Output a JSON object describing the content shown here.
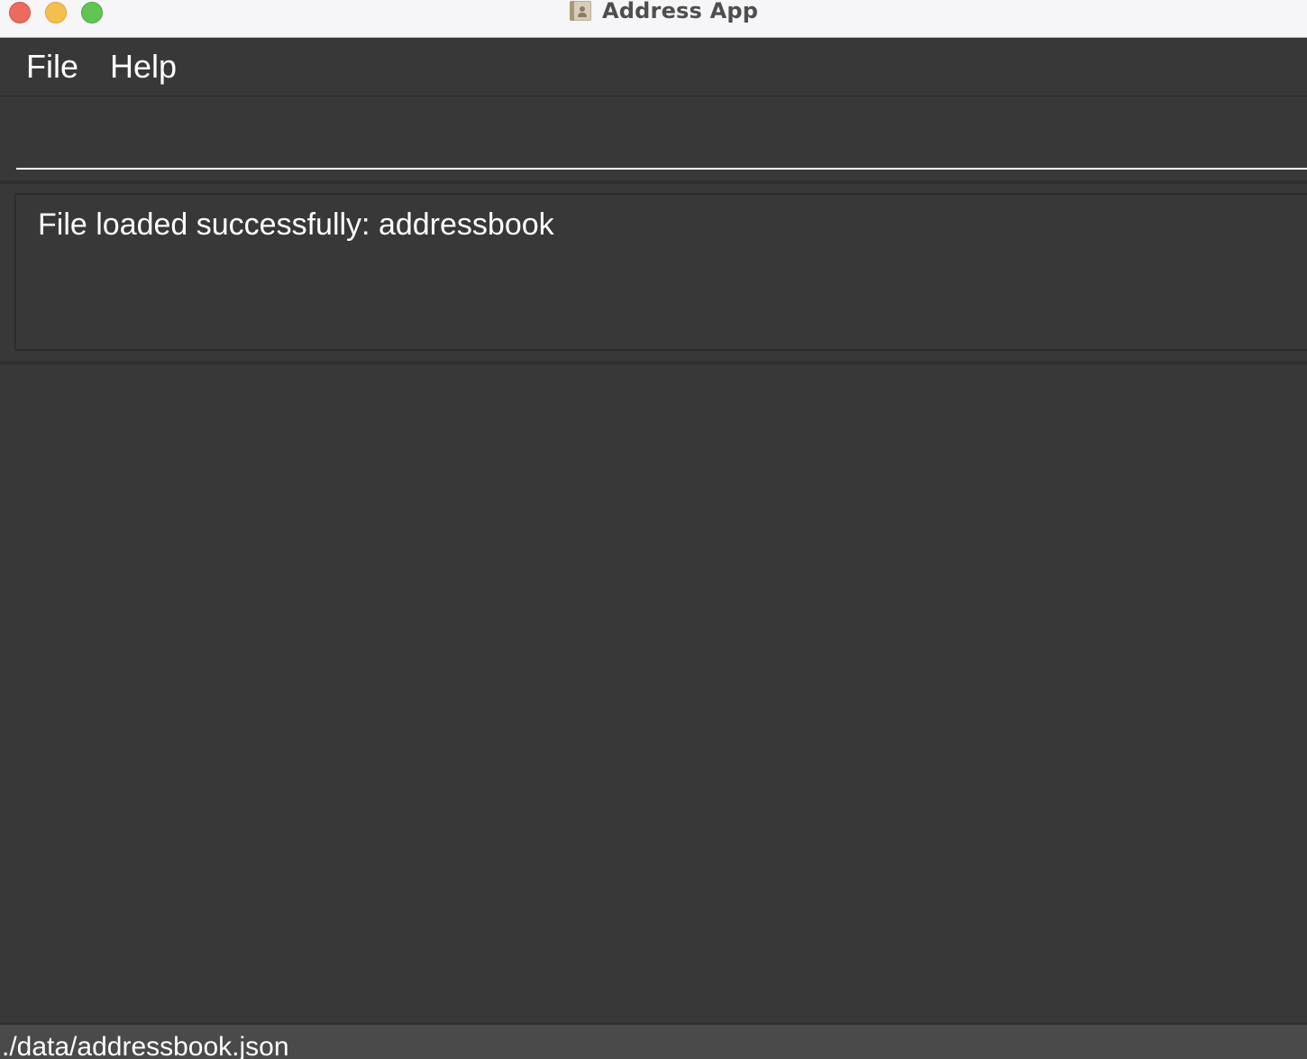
{
  "window": {
    "title": "Address App",
    "app_icon": "address-book-icon",
    "controls": [
      "close",
      "minimize",
      "zoom"
    ]
  },
  "menu": {
    "items": [
      {
        "label": "File"
      },
      {
        "label": "Help"
      }
    ]
  },
  "command_box": {
    "value": "",
    "placeholder": ""
  },
  "result_display": {
    "message": "File loaded successfully: addressbook"
  },
  "status_bar": {
    "save_location": "./data/addressbook.json"
  },
  "colors": {
    "background": "#383838",
    "text": "#ffffff",
    "titlebar": "#f6f5f7",
    "status_bar": "#4a4a4a"
  }
}
